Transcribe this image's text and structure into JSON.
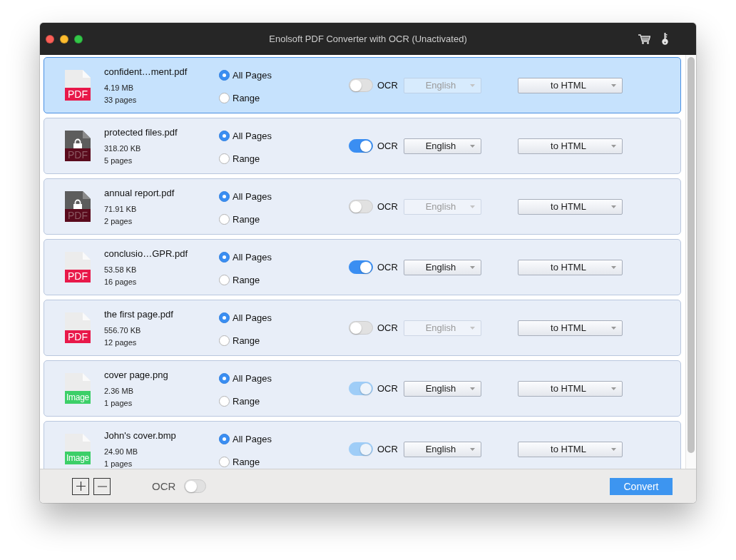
{
  "window": {
    "title": "Enolsoft PDF Converter with OCR (Unactivated)"
  },
  "files": [
    {
      "kind": "pdf",
      "badge": "PDF",
      "name": "confident…ment.pdf",
      "size": "4.19 MB",
      "pages": "33 pages",
      "selected": true,
      "page_options": [
        {
          "label": "All Pages",
          "selected": true
        },
        {
          "label": "Range",
          "selected": false
        }
      ],
      "ocr": {
        "label": "OCR",
        "on": false,
        "disabled": false
      },
      "language": {
        "value": "English",
        "disabled": true
      },
      "format": {
        "value": "to HTML"
      }
    },
    {
      "kind": "locked",
      "badge": "PDF",
      "name": "protected files.pdf",
      "size": "318.20 KB",
      "pages": "5 pages",
      "selected": false,
      "page_options": [
        {
          "label": "All Pages",
          "selected": true
        },
        {
          "label": "Range",
          "selected": false
        }
      ],
      "ocr": {
        "label": "OCR",
        "on": true,
        "disabled": false
      },
      "language": {
        "value": "English",
        "disabled": false
      },
      "format": {
        "value": "to HTML"
      }
    },
    {
      "kind": "locked",
      "badge": "PDF",
      "name": "annual report.pdf",
      "size": "71.91 KB",
      "pages": "2 pages",
      "selected": false,
      "page_options": [
        {
          "label": "All Pages",
          "selected": true
        },
        {
          "label": "Range",
          "selected": false
        }
      ],
      "ocr": {
        "label": "OCR",
        "on": false,
        "disabled": false
      },
      "language": {
        "value": "English",
        "disabled": true
      },
      "format": {
        "value": "to HTML"
      }
    },
    {
      "kind": "pdf",
      "badge": "PDF",
      "name": "conclusio…GPR.pdf",
      "size": "53.58 KB",
      "pages": "16 pages",
      "selected": false,
      "page_options": [
        {
          "label": "All Pages",
          "selected": true
        },
        {
          "label": "Range",
          "selected": false
        }
      ],
      "ocr": {
        "label": "OCR",
        "on": true,
        "disabled": false
      },
      "language": {
        "value": "English",
        "disabled": false
      },
      "format": {
        "value": "to HTML"
      }
    },
    {
      "kind": "pdf",
      "badge": "PDF",
      "name": "the first page.pdf",
      "size": "556.70 KB",
      "pages": "12 pages",
      "selected": false,
      "page_options": [
        {
          "label": "All Pages",
          "selected": true
        },
        {
          "label": "Range",
          "selected": false
        }
      ],
      "ocr": {
        "label": "OCR",
        "on": false,
        "disabled": false
      },
      "language": {
        "value": "English",
        "disabled": true
      },
      "format": {
        "value": "to HTML"
      }
    },
    {
      "kind": "image",
      "badge": "Image",
      "name": "cover page.png",
      "size": "2.36 MB",
      "pages": "1 pages",
      "selected": false,
      "page_options": [
        {
          "label": "All Pages",
          "selected": true
        },
        {
          "label": "Range",
          "selected": false
        }
      ],
      "ocr": {
        "label": "OCR",
        "on": true,
        "disabled": true
      },
      "language": {
        "value": "English",
        "disabled": false
      },
      "format": {
        "value": "to HTML"
      }
    },
    {
      "kind": "image",
      "badge": "Image",
      "name": "John's cover.bmp",
      "size": "24.90 MB",
      "pages": "1 pages",
      "selected": false,
      "page_options": [
        {
          "label": "All Pages",
          "selected": true
        },
        {
          "label": "Range",
          "selected": false
        }
      ],
      "ocr": {
        "label": "OCR",
        "on": true,
        "disabled": true
      },
      "language": {
        "value": "English",
        "disabled": false
      },
      "format": {
        "value": "to HTML"
      }
    }
  ],
  "bottom_bar": {
    "ocr": {
      "label": "OCR",
      "on": false
    },
    "convert_button": "Convert"
  }
}
